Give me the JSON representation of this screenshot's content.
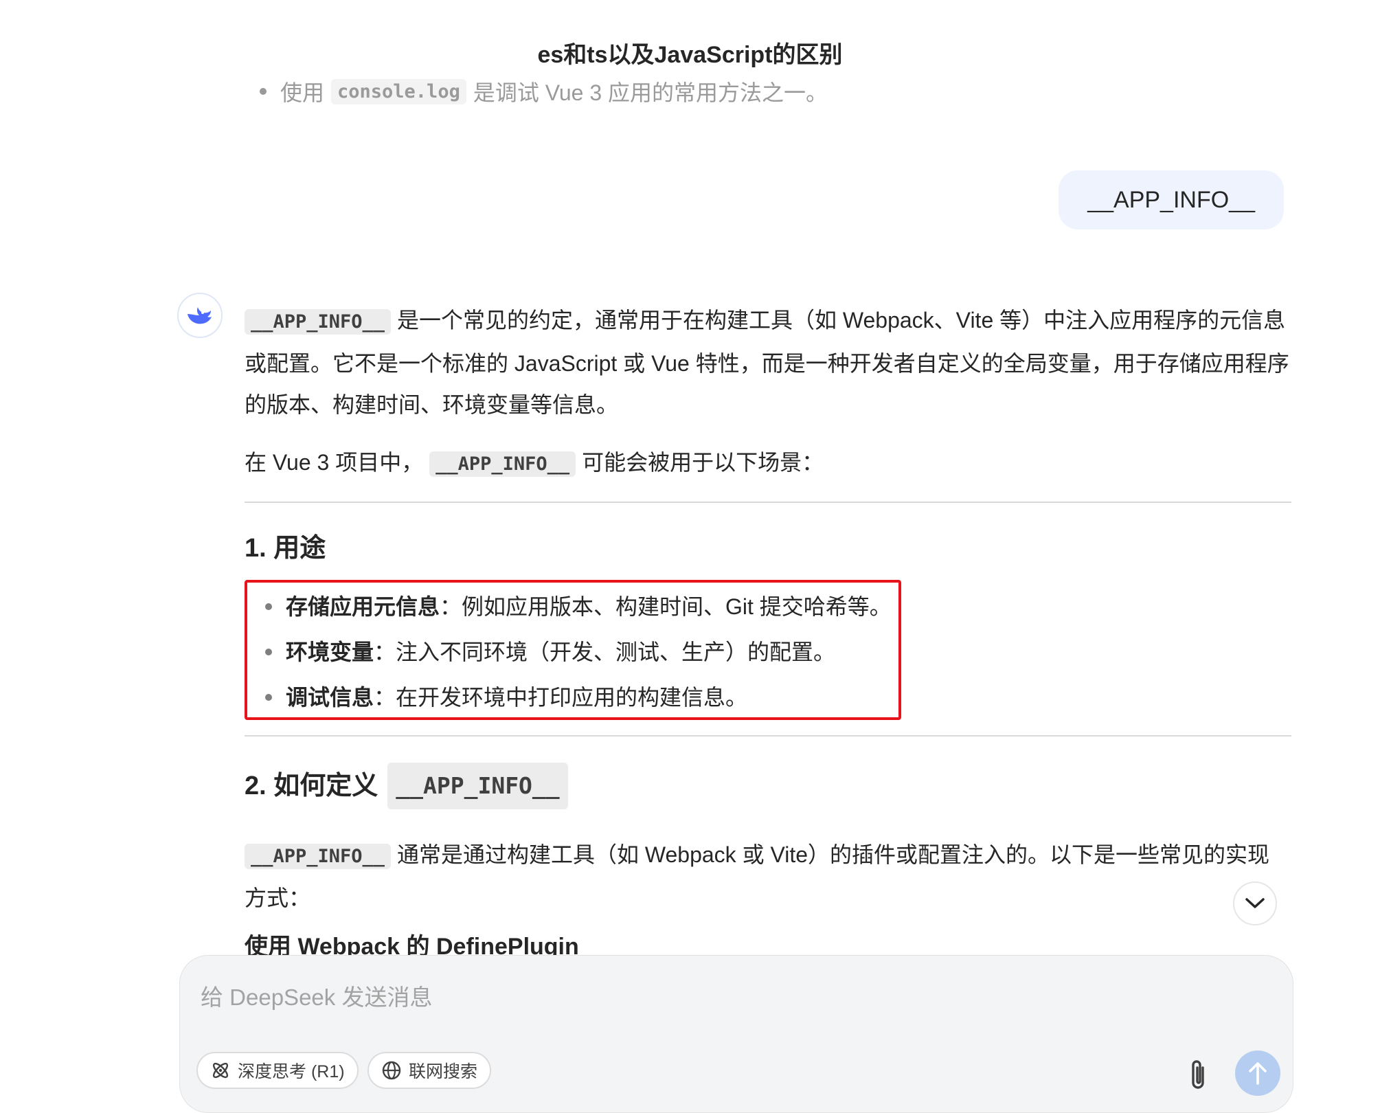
{
  "header": {
    "title": "es和ts以及JavaScript的区别"
  },
  "previous_message": {
    "text_before": "使用",
    "code": "console.log",
    "text_after": "是调试 Vue 3 应用的常用方法之一。"
  },
  "user_message": {
    "text": "__APP_INFO__"
  },
  "answer": {
    "p1_code": "__APP_INFO__",
    "p1_text": "是一个常见的约定，通常用于在构建工具（如 Webpack、Vite 等）中注入应用程序的元信息或配置。它不是一个标准的 JavaScript 或 Vue 特性，而是一种开发者自定义的全局变量，用于存储应用程序的版本、构建时间、环境变量等信息。",
    "p2_before": "在 Vue 3 项目中，",
    "p2_code": "__APP_INFO__",
    "p2_after": "可能会被用于以下场景：",
    "section1_heading": "1. 用途",
    "section1_items": [
      {
        "bold": "存储应用元信息",
        "text": "：例如应用版本、构建时间、Git 提交哈希等。"
      },
      {
        "bold": "环境变量",
        "text": "：注入不同环境（开发、测试、生产）的配置。"
      },
      {
        "bold": "调试信息",
        "text": "：在开发环境中打印应用的构建信息。"
      }
    ],
    "section2_heading": "2. 如何定义",
    "section2_code": "__APP_INFO__",
    "p3_code": "__APP_INFO__",
    "p3_text": "通常是通过构建工具（如 Webpack 或 Vite）的插件或配置注入的。以下是一些常见的实现方式：",
    "subheading": "使用 Webpack 的 DefinePlugin"
  },
  "composer": {
    "placeholder": "给 DeepSeek 发送消息",
    "deep_think_label": "深度思考 (R1)",
    "web_search_label": "联网搜索"
  },
  "colors": {
    "accent": "#4d6bfe",
    "highlight_box": "#e8141b",
    "send_button": "#b5cdf0",
    "user_bubble": "#eef3fd"
  },
  "icons": [
    "deepseek-logo-icon",
    "chevron-down-icon",
    "atom-icon",
    "globe-icon",
    "paperclip-icon",
    "arrow-up-icon"
  ]
}
